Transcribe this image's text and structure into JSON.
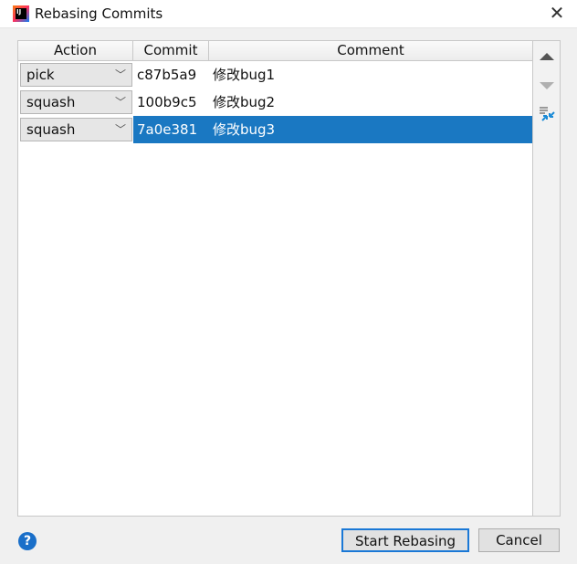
{
  "window": {
    "title": "Rebasing Commits"
  },
  "table": {
    "columns": [
      "Action",
      "Commit",
      "Comment"
    ],
    "rows": [
      {
        "action": "pick",
        "commit": "c87b5a9",
        "comment": "修改bug1",
        "selected": false
      },
      {
        "action": "squash",
        "commit": "100b9c5",
        "comment": "修改bug2",
        "selected": false
      },
      {
        "action": "squash",
        "commit": "7a0e381",
        "comment": "修改bug3",
        "selected": true
      }
    ]
  },
  "toolbar": {
    "icons": [
      "move-up-icon",
      "move-down-icon",
      "view-options-icon"
    ]
  },
  "buttons": {
    "start": "Start Rebasing",
    "cancel": "Cancel",
    "help": "?"
  },
  "colors": {
    "selection": "#1a78c2"
  }
}
